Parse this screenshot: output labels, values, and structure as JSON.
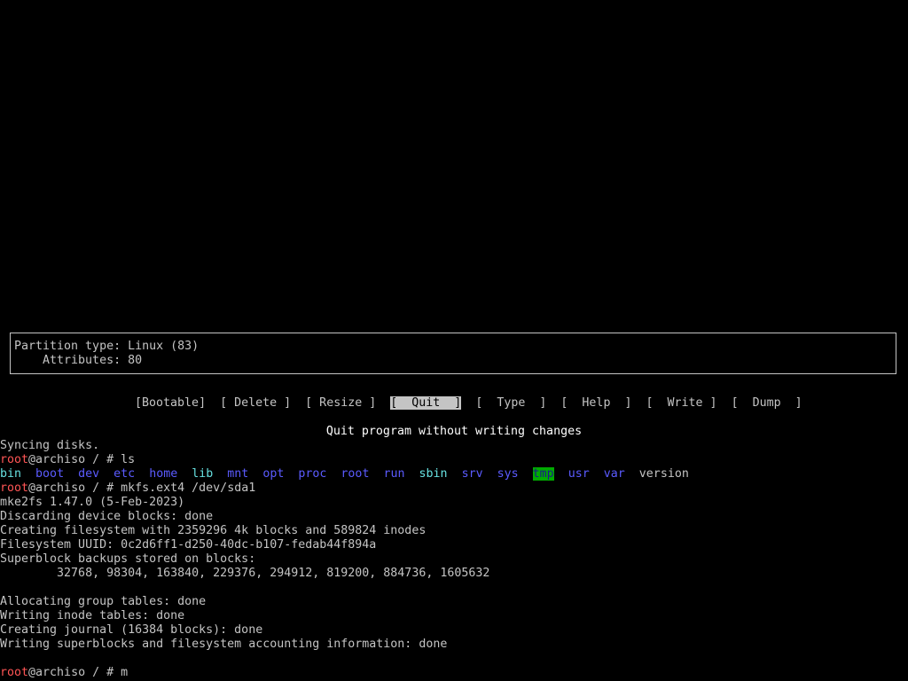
{
  "partition_info": {
    "type_line": "Partition type: Linux (83)",
    "attributes_line": "    Attributes: 80"
  },
  "menu": {
    "items": [
      {
        "label": "[Bootable]",
        "selected": false
      },
      {
        "label": "[ Delete ]",
        "selected": false
      },
      {
        "label": "[ Resize ]",
        "selected": false
      },
      {
        "label": "[  Quit  ]",
        "selected": true
      },
      {
        "label": "[  Type  ]",
        "selected": false
      },
      {
        "label": "[  Help  ]",
        "selected": false
      },
      {
        "label": "[  Write ]",
        "selected": false
      },
      {
        "label": "[  Dump  ]",
        "selected": false
      }
    ],
    "description": "Quit program without writing changes"
  },
  "terminal": {
    "user": "root",
    "prompt_suffix": "@archiso / # ",
    "lines": {
      "syncing": "Syncing disks.",
      "cmd_ls": "ls",
      "cmd_mkfs": "mkfs.ext4 /dev/sda1",
      "mke2fs_version": "mke2fs 1.47.0 (5-Feb-2023)",
      "discarding": "Discarding device blocks: done",
      "creating_fs": "Creating filesystem with 2359296 4k blocks and 589824 inodes",
      "uuid": "Filesystem UUID: 0c2d6ff1-d250-40dc-b107-fedab44f894a",
      "superblock_header": "Superblock backups stored on blocks:",
      "superblock_list": "        32768, 98304, 163840, 229376, 294912, 819200, 884736, 1605632",
      "alloc_group": "Allocating group tables: done",
      "inode_tables": "Writing inode tables: done",
      "journal": "Creating journal (16384 blocks): done",
      "superblocks_acct": "Writing superblocks and filesystem accounting information: done",
      "current_input": "m"
    },
    "ls_entries": [
      {
        "name": "bin",
        "kind": "cyan"
      },
      {
        "name": "boot",
        "kind": "dir"
      },
      {
        "name": "dev",
        "kind": "dir"
      },
      {
        "name": "etc",
        "kind": "dir"
      },
      {
        "name": "home",
        "kind": "dir"
      },
      {
        "name": "lib",
        "kind": "cyan"
      },
      {
        "name": "mnt",
        "kind": "dir"
      },
      {
        "name": "opt",
        "kind": "dir"
      },
      {
        "name": "proc",
        "kind": "dir"
      },
      {
        "name": "root",
        "kind": "dir"
      },
      {
        "name": "run",
        "kind": "dir"
      },
      {
        "name": "sbin",
        "kind": "cyan"
      },
      {
        "name": "srv",
        "kind": "dir"
      },
      {
        "name": "sys",
        "kind": "dir"
      },
      {
        "name": "tmp",
        "kind": "tmp"
      },
      {
        "name": "usr",
        "kind": "dir"
      },
      {
        "name": "var",
        "kind": "dir"
      },
      {
        "name": "version",
        "kind": "file"
      }
    ]
  },
  "colors": {
    "background": "#000000",
    "foreground": "#c4c4c4",
    "prompt_user": "#ff5555",
    "directory": "#5b5bff",
    "symlink": "#66e0e0",
    "tmp_background": "#00aa00"
  }
}
